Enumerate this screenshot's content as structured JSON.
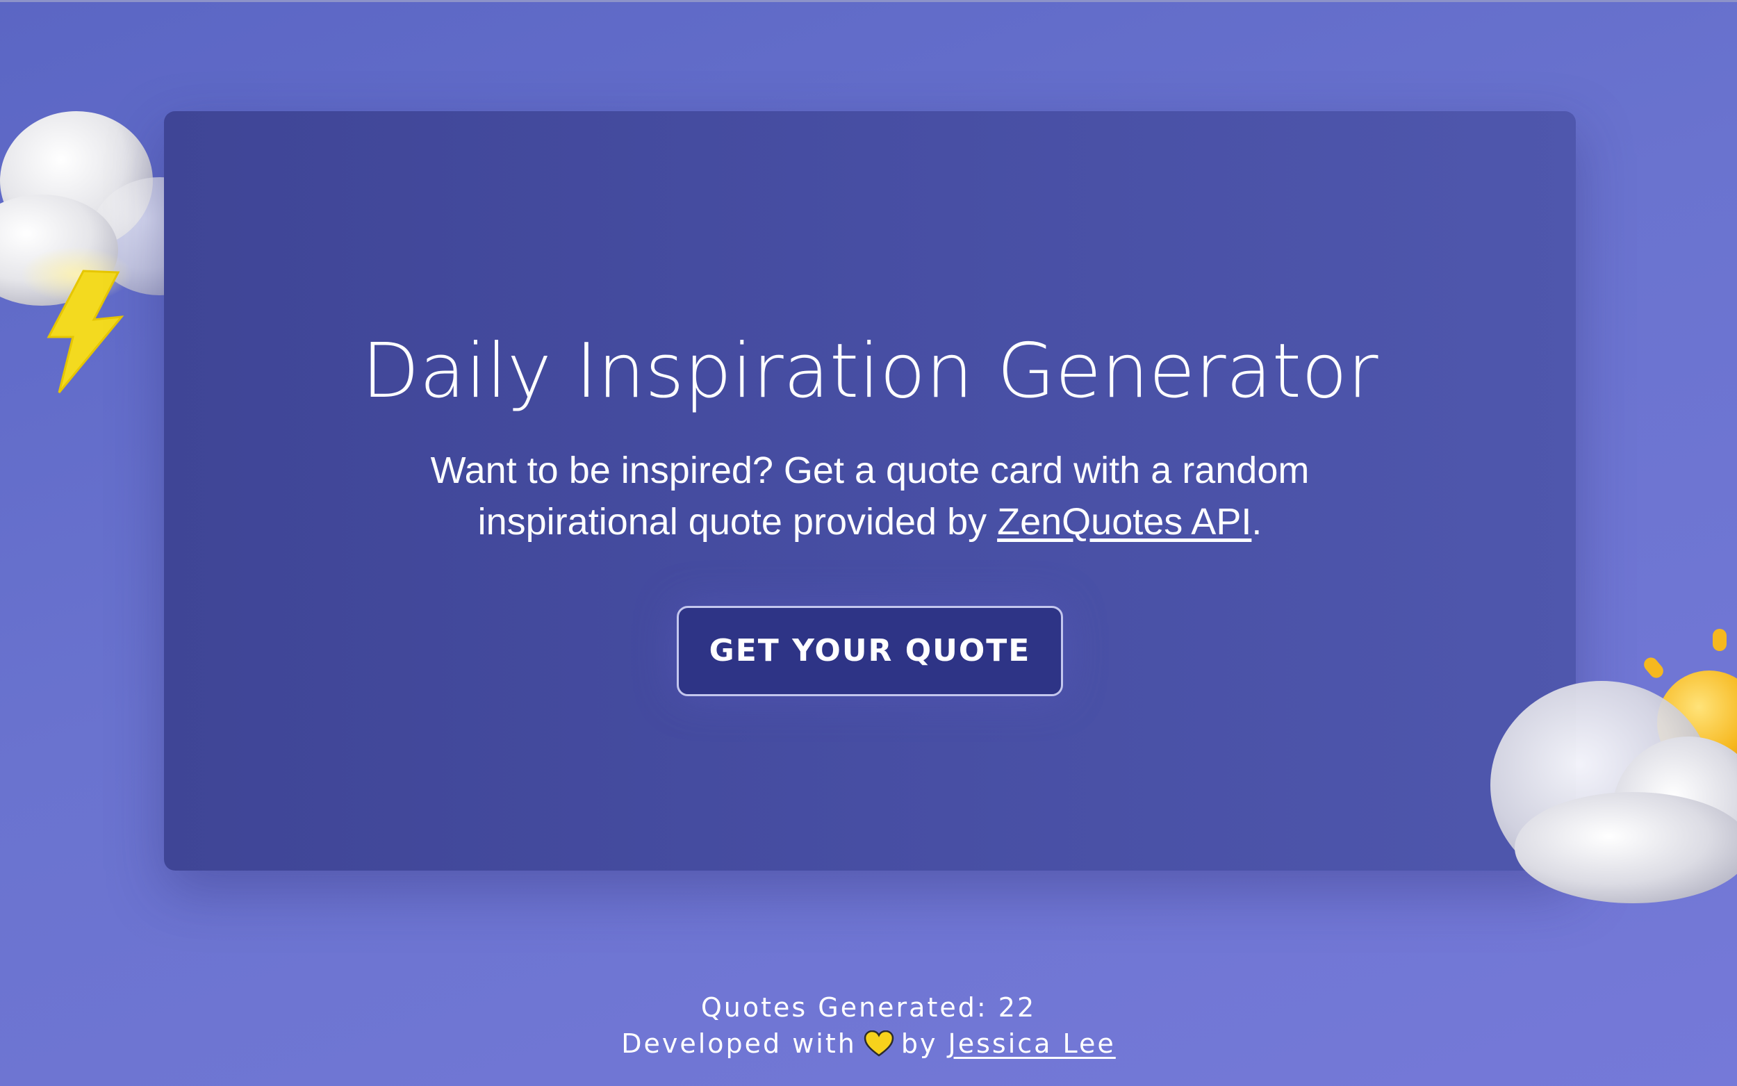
{
  "main": {
    "title": "Daily Inspiration Generator",
    "subtitle_text": "Want to be inspired? Get a quote card with a random inspirational quote provided by",
    "subtitle_link": "ZenQuotes API",
    "subtitle_end": ".",
    "button_label": "GET YOUR QUOTE"
  },
  "footer": {
    "counter_label": "Quotes Generated:",
    "counter_value": "22",
    "credit_prefix": "Developed with",
    "credit_by": "by",
    "author_link": "Jessica Lee"
  },
  "icons": {
    "heart": "heart-icon",
    "storm_cloud": "storm-cloud-icon",
    "sun_cloud": "sun-behind-cloud-icon"
  },
  "colors": {
    "background": "#6a73cf",
    "card": "#474ea3",
    "button": "#2e3486",
    "heart": "#f7d21c",
    "lightning": "#f3da1f"
  }
}
